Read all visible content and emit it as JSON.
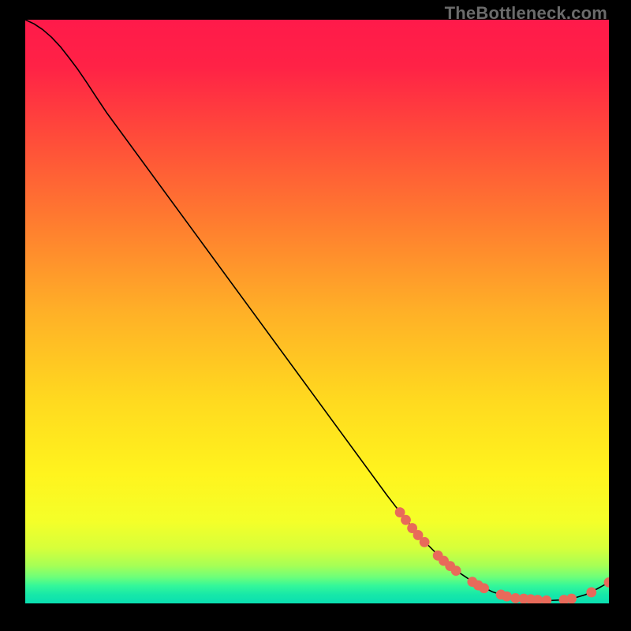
{
  "watermark": "TheBottleneck.com",
  "chart_data": {
    "type": "line",
    "title": "",
    "xlabel": "",
    "ylabel": "",
    "xlim": [
      0,
      100
    ],
    "ylim": [
      0,
      100
    ],
    "grid": false,
    "background_gradient": {
      "stops": [
        {
          "offset": 0.0,
          "color": "#ff1a4a"
        },
        {
          "offset": 0.08,
          "color": "#ff2246"
        },
        {
          "offset": 0.2,
          "color": "#ff4b3a"
        },
        {
          "offset": 0.35,
          "color": "#ff7d2f"
        },
        {
          "offset": 0.5,
          "color": "#ffb027"
        },
        {
          "offset": 0.65,
          "color": "#ffd91f"
        },
        {
          "offset": 0.78,
          "color": "#fff41e"
        },
        {
          "offset": 0.86,
          "color": "#f4ff29"
        },
        {
          "offset": 0.905,
          "color": "#d7ff3a"
        },
        {
          "offset": 0.935,
          "color": "#a7ff55"
        },
        {
          "offset": 0.955,
          "color": "#6dff7a"
        },
        {
          "offset": 0.97,
          "color": "#33f79a"
        },
        {
          "offset": 0.985,
          "color": "#17e8a8"
        },
        {
          "offset": 1.0,
          "color": "#0adfb1"
        }
      ]
    },
    "series": [
      {
        "name": "bottleneck-curve",
        "color": "#000000",
        "width": 1.6,
        "x": [
          0.0,
          1.5,
          3.0,
          4.5,
          6.0,
          7.5,
          9.0,
          10.5,
          12.0,
          14.0,
          62.0,
          65.0,
          68.0,
          71.0,
          74.0,
          77.0,
          80.0,
          82.5,
          85.0,
          87.5,
          90.0,
          92.0,
          94.0,
          96.0,
          98.0,
          100.0
        ],
        "y": [
          100.0,
          99.3,
          98.3,
          97.0,
          95.4,
          93.5,
          91.5,
          89.3,
          87.0,
          84.0,
          18.5,
          14.6,
          11.0,
          8.0,
          5.5,
          3.5,
          2.0,
          1.2,
          0.8,
          0.6,
          0.5,
          0.6,
          0.9,
          1.5,
          2.5,
          3.6
        ]
      }
    ],
    "markers": [
      {
        "name": "highlight-points",
        "shape": "circle",
        "color": "#e86a5a",
        "radius": 6.4,
        "points": [
          {
            "x": 64.2,
            "y": 15.6
          },
          {
            "x": 65.2,
            "y": 14.3
          },
          {
            "x": 66.3,
            "y": 12.9
          },
          {
            "x": 67.3,
            "y": 11.7
          },
          {
            "x": 68.4,
            "y": 10.5
          },
          {
            "x": 70.7,
            "y": 8.2
          },
          {
            "x": 71.7,
            "y": 7.3
          },
          {
            "x": 72.8,
            "y": 6.4
          },
          {
            "x": 73.8,
            "y": 5.6
          },
          {
            "x": 76.6,
            "y": 3.7
          },
          {
            "x": 77.6,
            "y": 3.1
          },
          {
            "x": 78.6,
            "y": 2.6
          },
          {
            "x": 81.5,
            "y": 1.5
          },
          {
            "x": 82.5,
            "y": 1.2
          },
          {
            "x": 84.0,
            "y": 0.9
          },
          {
            "x": 85.4,
            "y": 0.8
          },
          {
            "x": 86.6,
            "y": 0.7
          },
          {
            "x": 87.8,
            "y": 0.6
          },
          {
            "x": 89.3,
            "y": 0.5
          },
          {
            "x": 92.3,
            "y": 0.6
          },
          {
            "x": 93.6,
            "y": 0.8
          },
          {
            "x": 97.0,
            "y": 1.9
          },
          {
            "x": 100.0,
            "y": 3.6
          }
        ]
      }
    ]
  }
}
